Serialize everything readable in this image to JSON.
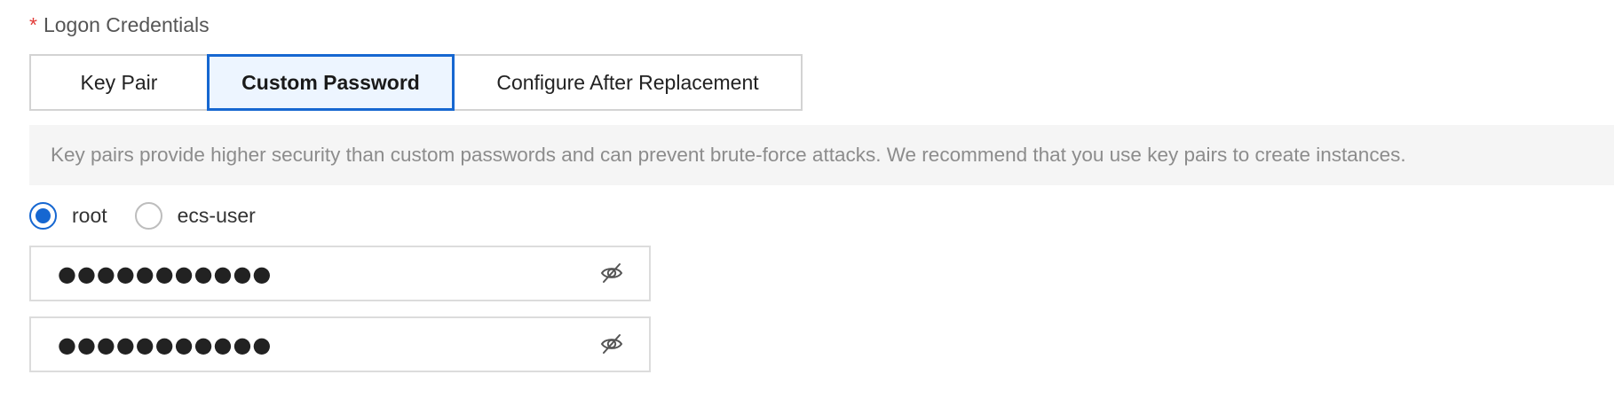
{
  "logon": {
    "required_mark": "*",
    "label": "Logon Credentials"
  },
  "tabs": [
    {
      "label": "Key Pair",
      "active": false
    },
    {
      "label": "Custom Password",
      "active": true
    },
    {
      "label": "Configure After Replacement",
      "active": false
    }
  ],
  "notice": {
    "text": "Key pairs provide higher security than custom passwords and can prevent brute-force attacks. We recommend that you use key pairs to create instances."
  },
  "user_options": [
    {
      "label": "root",
      "checked": true
    },
    {
      "label": "ecs-user",
      "checked": false
    }
  ],
  "password": {
    "value": "●●●●●●●●●●●",
    "toggle_icon": "eye-slash-icon"
  },
  "confirm_password": {
    "value": "●●●●●●●●●●●",
    "toggle_icon": "eye-slash-icon"
  },
  "colors": {
    "accent": "#1667d1",
    "active_tab_bg": "#edf5ff",
    "required": "#e23c39",
    "notice_bg": "#f5f5f5",
    "notice_text": "#8c8c8c"
  }
}
